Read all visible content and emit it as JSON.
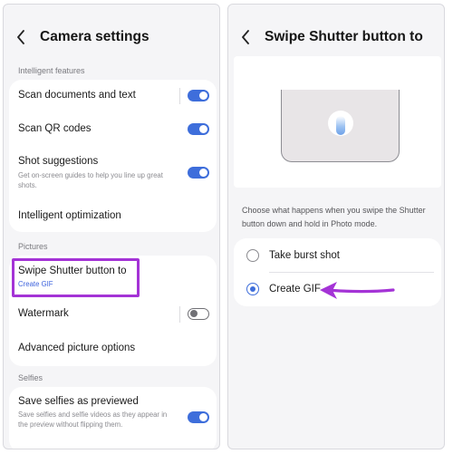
{
  "left_panel": {
    "title": "Camera settings",
    "sections": {
      "intelligent": "Intelligent features",
      "pictures": "Pictures",
      "selfies": "Selfies"
    },
    "rows": {
      "scan_documents": {
        "title": "Scan documents and text",
        "toggle": "on"
      },
      "scan_qr": {
        "title": "Scan QR codes",
        "toggle": "on"
      },
      "shot_suggestions": {
        "title": "Shot suggestions",
        "subtitle": "Get on-screen guides to help you line up great shots.",
        "toggle": "on"
      },
      "intelligent_optimization": {
        "title": "Intelligent optimization"
      },
      "swipe_shutter": {
        "title": "Swipe Shutter button to",
        "subtitle": "Create GIF"
      },
      "watermark": {
        "title": "Watermark",
        "toggle": "off"
      },
      "advanced_picture": {
        "title": "Advanced picture options"
      },
      "save_selfies": {
        "title": "Save selfies as previewed",
        "subtitle": "Save selfies and selfie videos as they appear in the preview without flipping them.",
        "toggle": "on"
      }
    }
  },
  "right_panel": {
    "title": "Swipe Shutter button to",
    "description": "Choose what happens when you swipe the Shutter button down and hold in Photo mode.",
    "options": [
      {
        "label": "Take burst shot",
        "selected": false
      },
      {
        "label": "Create GIF",
        "selected": true
      }
    ]
  },
  "colors": {
    "accent_blue": "#3e6edb",
    "highlight_purple": "#a433d6",
    "background": "#f5f5f7"
  },
  "icons": [
    "back-arrow-icon",
    "toggle-switch",
    "radio-button",
    "shutter-button-illustration",
    "pointer-arrow"
  ]
}
